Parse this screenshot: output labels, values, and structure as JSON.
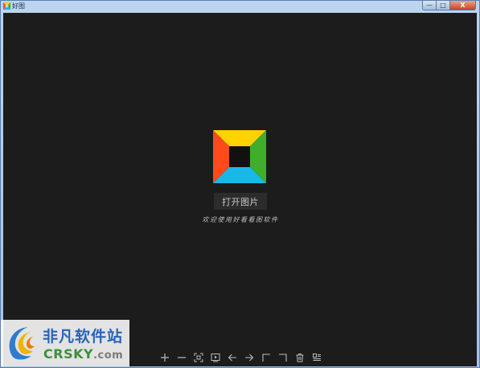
{
  "window": {
    "title": "好图",
    "controls": {
      "minimize": "—",
      "maximize": "□",
      "close": "X"
    }
  },
  "viewer": {
    "open_button_label": "打开图片",
    "welcome_text": "欢迎使用好看看图软件"
  },
  "toolbar": {
    "buttons": [
      {
        "name": "zoom-in-icon"
      },
      {
        "name": "zoom-out-icon"
      },
      {
        "name": "fit-screen-icon"
      },
      {
        "name": "slideshow-icon"
      },
      {
        "name": "previous-icon"
      },
      {
        "name": "next-icon"
      },
      {
        "name": "rotate-left-icon"
      },
      {
        "name": "rotate-right-icon"
      },
      {
        "name": "delete-icon"
      },
      {
        "name": "info-icon"
      }
    ]
  },
  "watermark": {
    "name": "非凡软件站",
    "domain_main": "CRSKY",
    "domain_tld": ".com"
  },
  "colors": {
    "viewer_background": "#1c1c1c",
    "logo_yellow": "#ffd200",
    "logo_green": "#3fae2a",
    "logo_cyan": "#1ab8e8",
    "logo_red": "#ff4a1c"
  }
}
